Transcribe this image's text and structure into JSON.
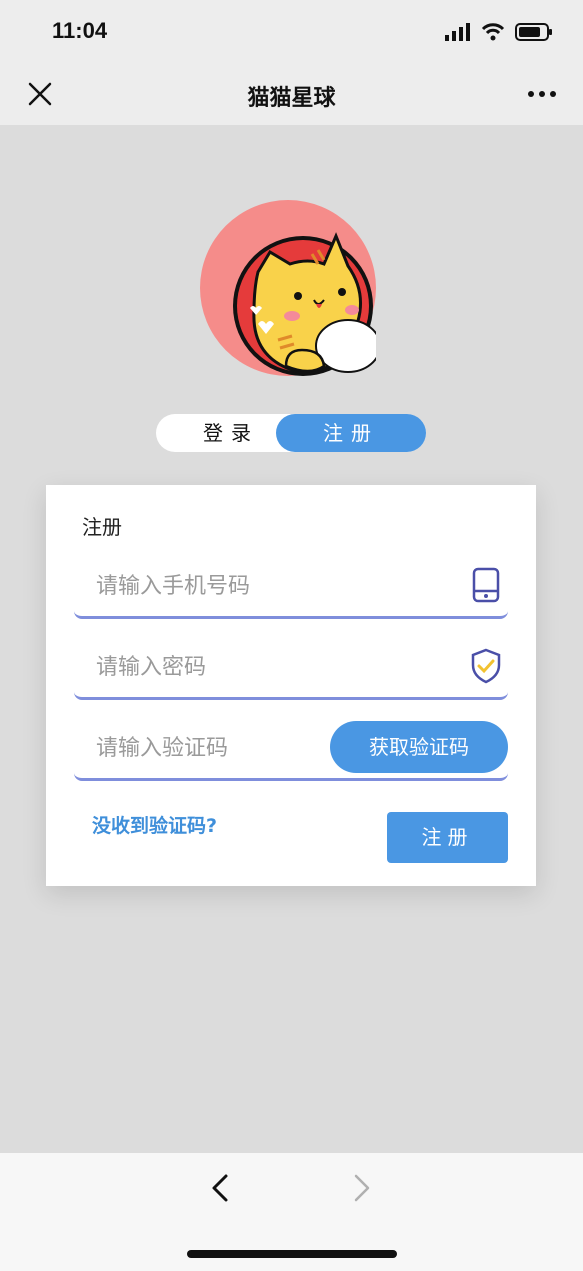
{
  "status_bar": {
    "time": "11:04"
  },
  "nav": {
    "title": "猫猫星球"
  },
  "toggle": {
    "login_label": "登录",
    "register_label": "注册"
  },
  "form": {
    "title": "注册",
    "phone_placeholder": "请输入手机号码",
    "password_placeholder": "请输入密码",
    "code_placeholder": "请输入验证码",
    "get_code_label": "获取验证码",
    "resend_link": "没收到验证码?",
    "submit_label": "注册"
  },
  "icons": {
    "close": "close-icon",
    "more": "more-icon",
    "phone": "phone-icon",
    "shield": "shield-check-icon",
    "back": "chevron-left-icon",
    "forward": "chevron-right-icon"
  },
  "colors": {
    "accent": "#4a97e3",
    "field_underline": "#7f8edc",
    "link": "#3f8fda",
    "background": "#dcdcdc"
  }
}
